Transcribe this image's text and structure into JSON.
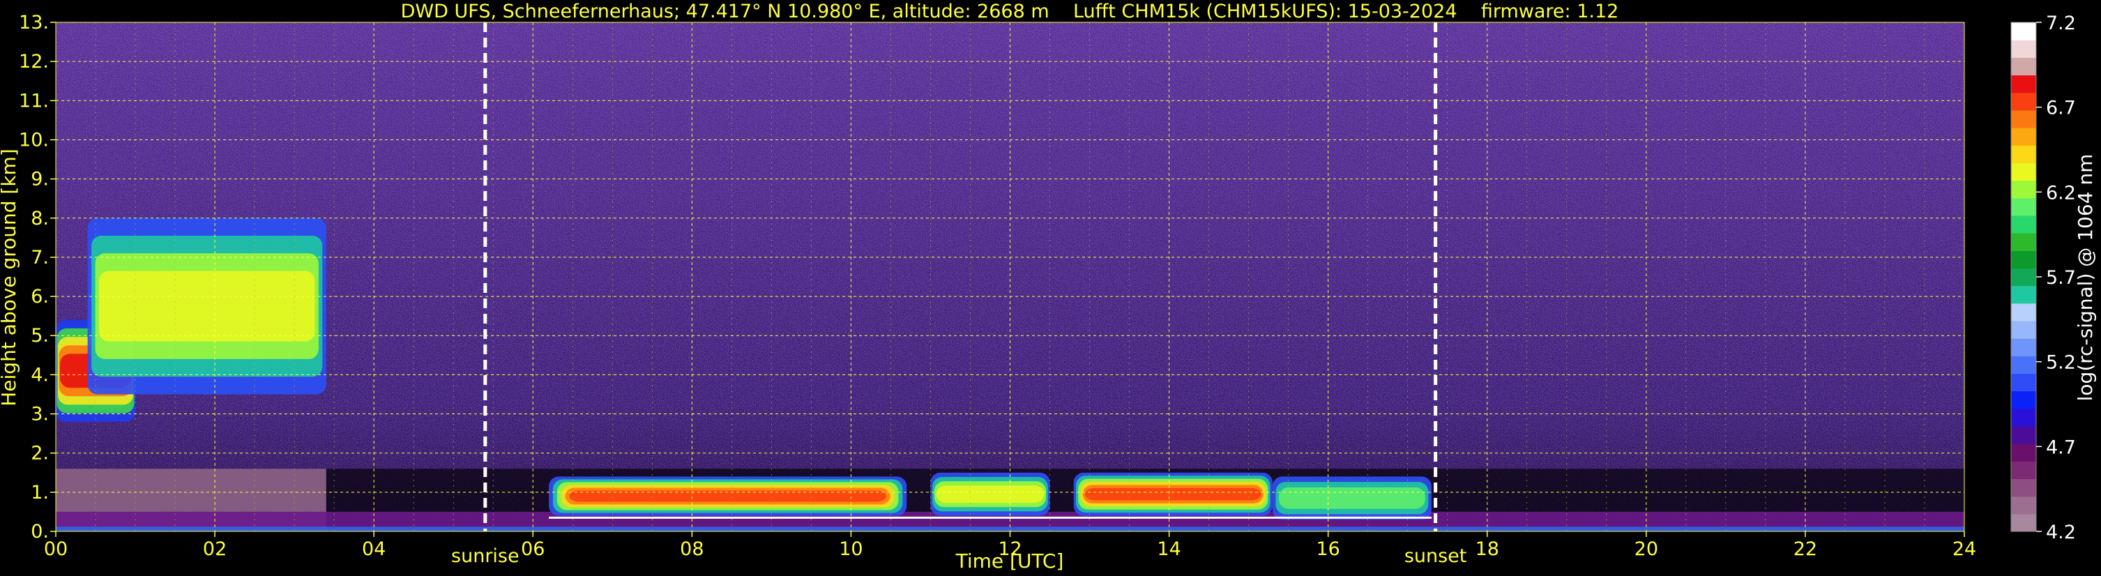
{
  "chart_data": {
    "type": "heatmap",
    "title": "DWD UFS, Schneefernerhaus; 47.417° N 10.980° E, altitude: 2668 m    Lufft CHM15k (CHM15kUFS): 15-03-2024    firmware: 1.12",
    "xlabel": "Time [UTC]",
    "ylabel": "Height above ground [km]",
    "xlim": [
      0,
      24
    ],
    "ylim": [
      0,
      13
    ],
    "x_ticks": [
      "00",
      "02",
      "04",
      "06",
      "08",
      "10",
      "12",
      "14",
      "16",
      "18",
      "20",
      "22",
      "24"
    ],
    "y_ticks": [
      "0.",
      "1.",
      "2.",
      "3.",
      "4.",
      "5.",
      "6.",
      "7.",
      "8.",
      "9.",
      "10.",
      "11.",
      "12.",
      "13."
    ],
    "grid": true,
    "events": [
      {
        "label": "sunrise",
        "x": 5.4
      },
      {
        "label": "sunset",
        "x": 17.35
      }
    ],
    "colorbar": {
      "label": "log(rc-signal) @ 1064 nm",
      "range": [
        4.2,
        7.2
      ],
      "ticks": [
        "4.2",
        "4.7",
        "5.2",
        "5.7",
        "6.2",
        "6.7",
        "7.2"
      ],
      "colors": [
        "#a9879e",
        "#9c6e90",
        "#8d4f82",
        "#7b2a74",
        "#6a0f6a",
        "#4a0d9a",
        "#2b10d8",
        "#0a22f8",
        "#2f4cf6",
        "#4a72f8",
        "#6f95fa",
        "#97b6fb",
        "#b9cffc",
        "#1ec8a0",
        "#12a858",
        "#0c9a2a",
        "#2eb82c",
        "#28d86a",
        "#5ef06a",
        "#9ef83a",
        "#e8f820",
        "#fcd818",
        "#fca810",
        "#fc7810",
        "#f84010",
        "#e81010",
        "#d0a8a8",
        "#f0d8d8",
        "#ffffff"
      ]
    },
    "cloud_layers": [
      {
        "name": "",
        "x_start": 0.0,
        "x_end": 1.0,
        "height_base_km": 2.8,
        "height_top_km": 5.4
      },
      {
        "name": "",
        "x_start": 0.4,
        "x_end": 3.4,
        "height_base_km": 3.5,
        "height_top_km": 8.0
      },
      {
        "name": "",
        "x_start": 6.2,
        "x_end": 10.7,
        "height_base_km": 0.4,
        "height_top_km": 1.4
      },
      {
        "name": "",
        "x_start": 11.0,
        "x_end": 12.5,
        "height_base_km": 0.4,
        "height_top_km": 1.5
      },
      {
        "name": "",
        "x_start": 12.8,
        "x_end": 15.3,
        "height_base_km": 0.4,
        "height_top_km": 1.5
      },
      {
        "name": "",
        "x_start": 15.3,
        "x_end": 17.3,
        "height_base_km": 0.3,
        "height_top_km": 1.4
      }
    ]
  }
}
